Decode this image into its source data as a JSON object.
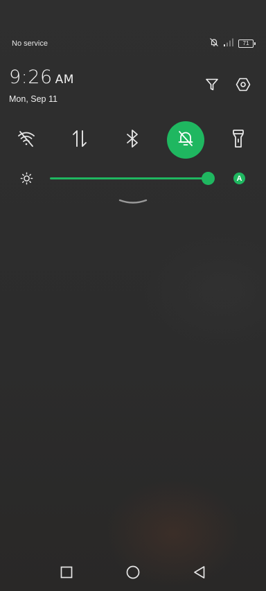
{
  "status_bar": {
    "carrier": "No service",
    "battery_level": "71",
    "icons": [
      "notifications-off-icon",
      "signal-weak-icon",
      "battery-icon"
    ]
  },
  "header": {
    "time": "9:26",
    "ampm": "AM",
    "date": "Mon, Sep 11",
    "actions": [
      "filter-icon",
      "settings-hexagon-icon"
    ]
  },
  "quick_tiles": [
    {
      "name": "wifi-off",
      "icon": "wifi-off-icon",
      "active": false
    },
    {
      "name": "mobile-data",
      "icon": "data-arrows-icon",
      "active": false
    },
    {
      "name": "bluetooth",
      "icon": "bluetooth-icon",
      "active": false
    },
    {
      "name": "do-not-disturb",
      "icon": "bell-off-icon",
      "active": true
    },
    {
      "name": "flashlight",
      "icon": "flashlight-icon",
      "active": false
    }
  ],
  "brightness": {
    "level": 0.95,
    "auto_label": "A"
  },
  "colors": {
    "accent": "#1fb760",
    "background": "#2d2d2d",
    "icon": "#e6e6e6"
  },
  "nav": {
    "buttons": [
      "recents-icon",
      "home-icon",
      "back-icon"
    ]
  }
}
